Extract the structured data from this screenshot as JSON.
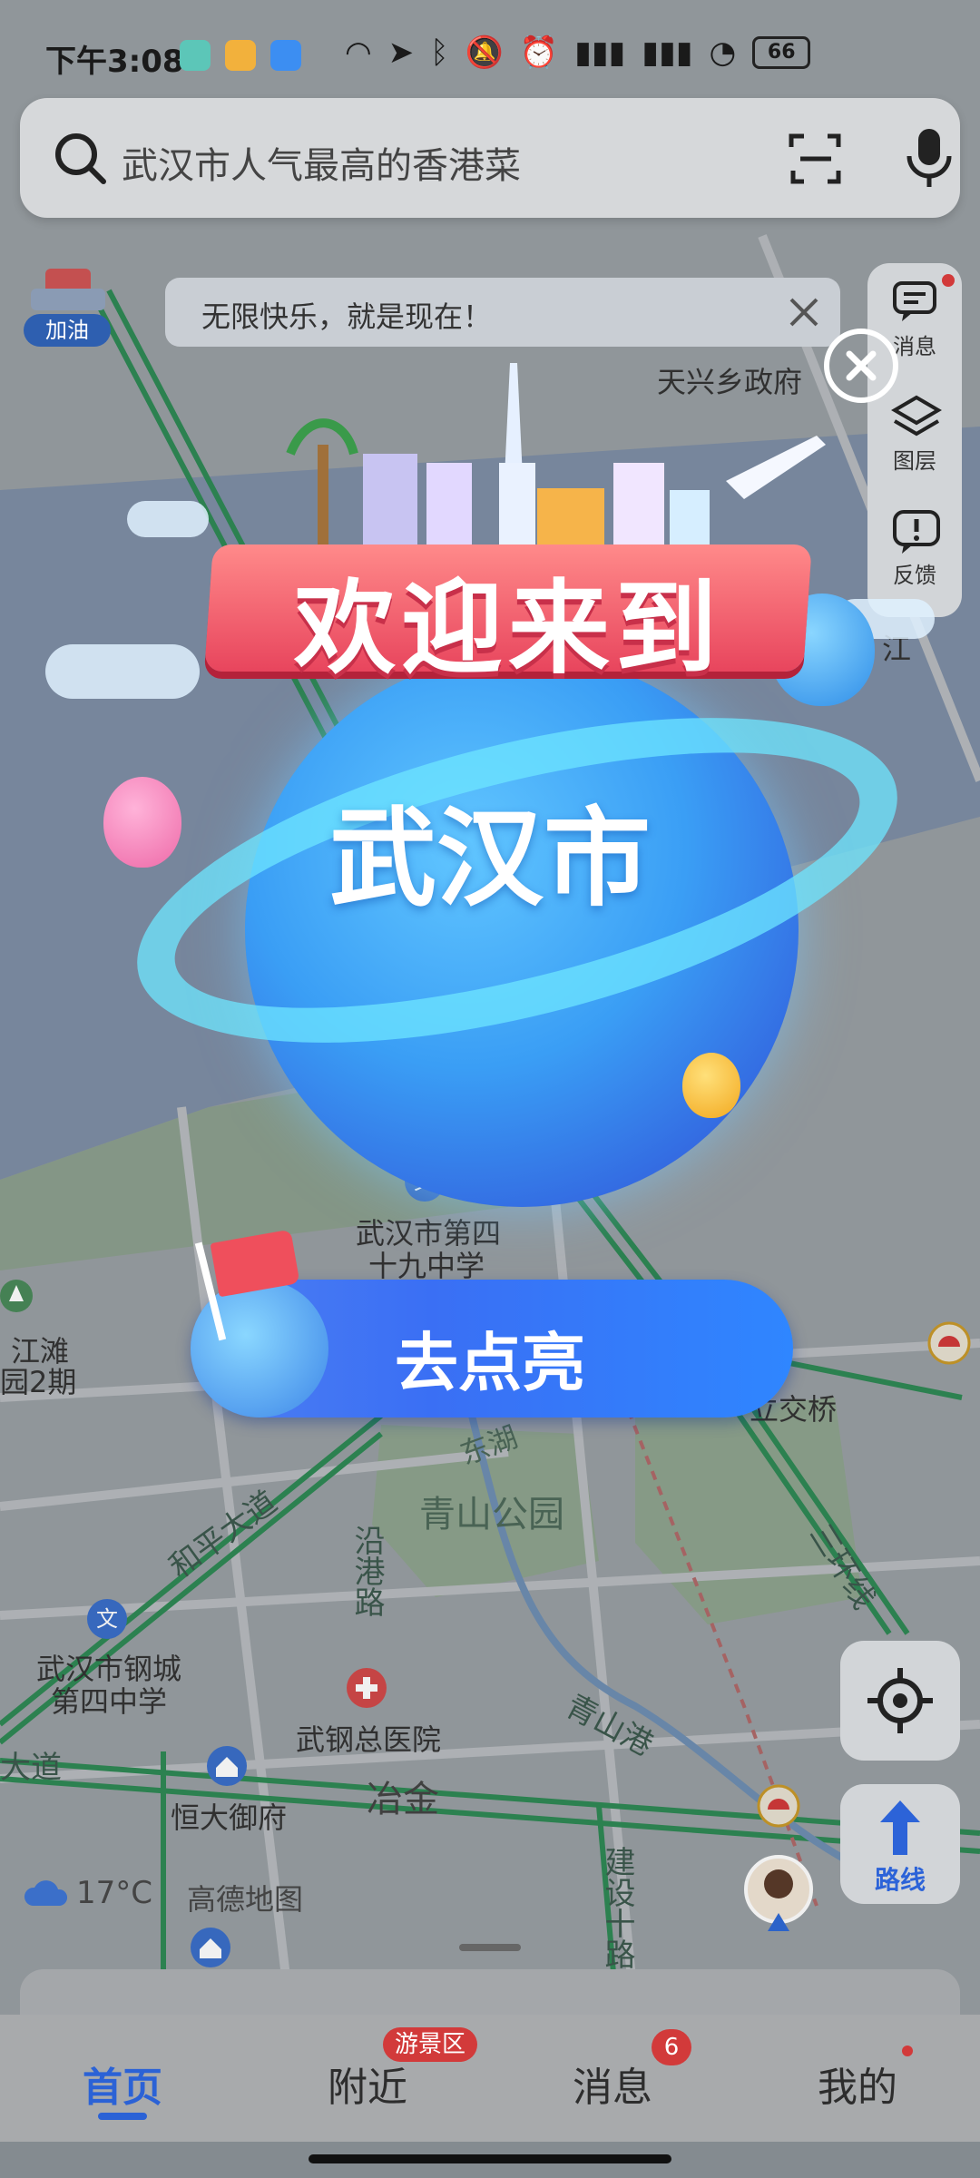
{
  "status_bar": {
    "time": "下午3:08",
    "battery": "66"
  },
  "search": {
    "placeholder": "武汉市人气最高的香港菜"
  },
  "fuel_marker": {
    "label": "加油"
  },
  "notice": {
    "text": "无限快乐，就是现在！"
  },
  "right_panel": {
    "items": [
      {
        "label": "消息",
        "icon": "message-icon"
      },
      {
        "label": "图层",
        "icon": "layers-icon"
      },
      {
        "label": "反馈",
        "icon": "feedback-icon"
      }
    ]
  },
  "popup": {
    "banner": "欢迎来到",
    "city": "武汉市",
    "cta": "去点亮"
  },
  "map_labels": {
    "tianxing": "天兴乡政府",
    "school49_line1": "武汉市第四",
    "school49_line2": "十九中学",
    "jiangtan_line1": "江滩",
    "jiangtan_line2": "园2期",
    "lijiaoqiao": "立交桥",
    "donghu": "东湖",
    "qingshan_park": "青山公园",
    "heping": "和平大道",
    "yangang": "沿港路",
    "sanhuan": "三环线",
    "gangcheng_line1": "武汉市钢城",
    "gangcheng_line2": "第四中学",
    "hospital": "武钢总医院",
    "qingshangang": "青山港",
    "dadao": "大道",
    "hengda": "恒大御府",
    "yejin": "冶金",
    "jianshe": "建设十路",
    "jiang": "江"
  },
  "weather": {
    "temp": "17°C"
  },
  "brand": "高德地图",
  "route_button": {
    "label": "路线"
  },
  "tabs": [
    {
      "label": "首页",
      "active": true
    },
    {
      "label": "附近",
      "badge": "游景区"
    },
    {
      "label": "消息",
      "badge": "6"
    },
    {
      "label": "我的",
      "dot": true
    }
  ]
}
